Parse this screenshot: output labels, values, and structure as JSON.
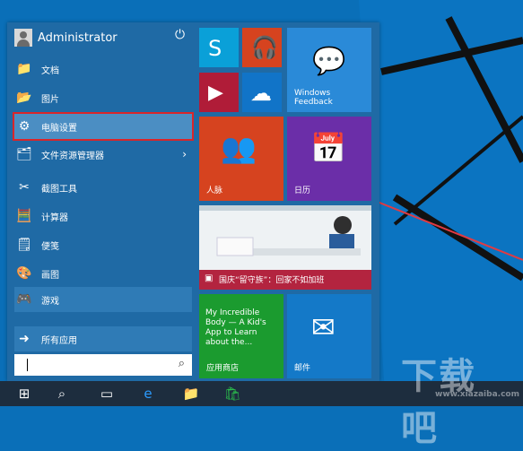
{
  "colors": {
    "start_background": "#1f6aa5",
    "skype": "#0aa0d8",
    "music": "#d6431f",
    "video": "#b01c38",
    "onedrive": "#1174c8",
    "feedback": "#2a8ad8",
    "people": "#d6431f",
    "calendar": "#6b2ea8",
    "news_footer": "#b3243f",
    "store": "#1b9b2f",
    "mail": "#1479c8",
    "selection_outline": "#d9252a",
    "taskbar": "#1d2d3e"
  },
  "start_menu": {
    "user": {
      "name": "Administrator",
      "avatar_icon": "user-avatar-icon",
      "power_icon": "power-icon"
    },
    "items": [
      {
        "label": "文档",
        "icon": "folder-icon"
      },
      {
        "label": "图片",
        "icon": "pictures-folder-icon"
      },
      {
        "label": "电脑设置",
        "icon": "gear-icon"
      },
      {
        "label": "文件资源管理器",
        "icon": "file-explorer-icon",
        "has_submenu": true
      },
      {
        "label": "截图工具",
        "icon": "snipping-tool-icon"
      },
      {
        "label": "计算器",
        "icon": "calculator-icon"
      },
      {
        "label": "便笺",
        "icon": "sticky-notes-icon"
      },
      {
        "label": "画图",
        "icon": "paint-icon"
      },
      {
        "label": "游戏",
        "icon": "xbox-icon"
      }
    ],
    "all_apps_label": "所有应用",
    "search": {
      "value": "",
      "icon": "search-icon"
    }
  },
  "tiles": {
    "feedback_label": "Windows Feedback",
    "people_label": "人脉",
    "calendar_label": "日历",
    "news_caption": "国庆“留守族”：回家不如加班",
    "store_text": "My Incredible Body — A Kid's App to Learn about the...",
    "store_label": "应用商店",
    "mail_label": "邮件"
  },
  "watermark": {
    "main": "下载吧",
    "url": "www.xiazaiba.com"
  }
}
